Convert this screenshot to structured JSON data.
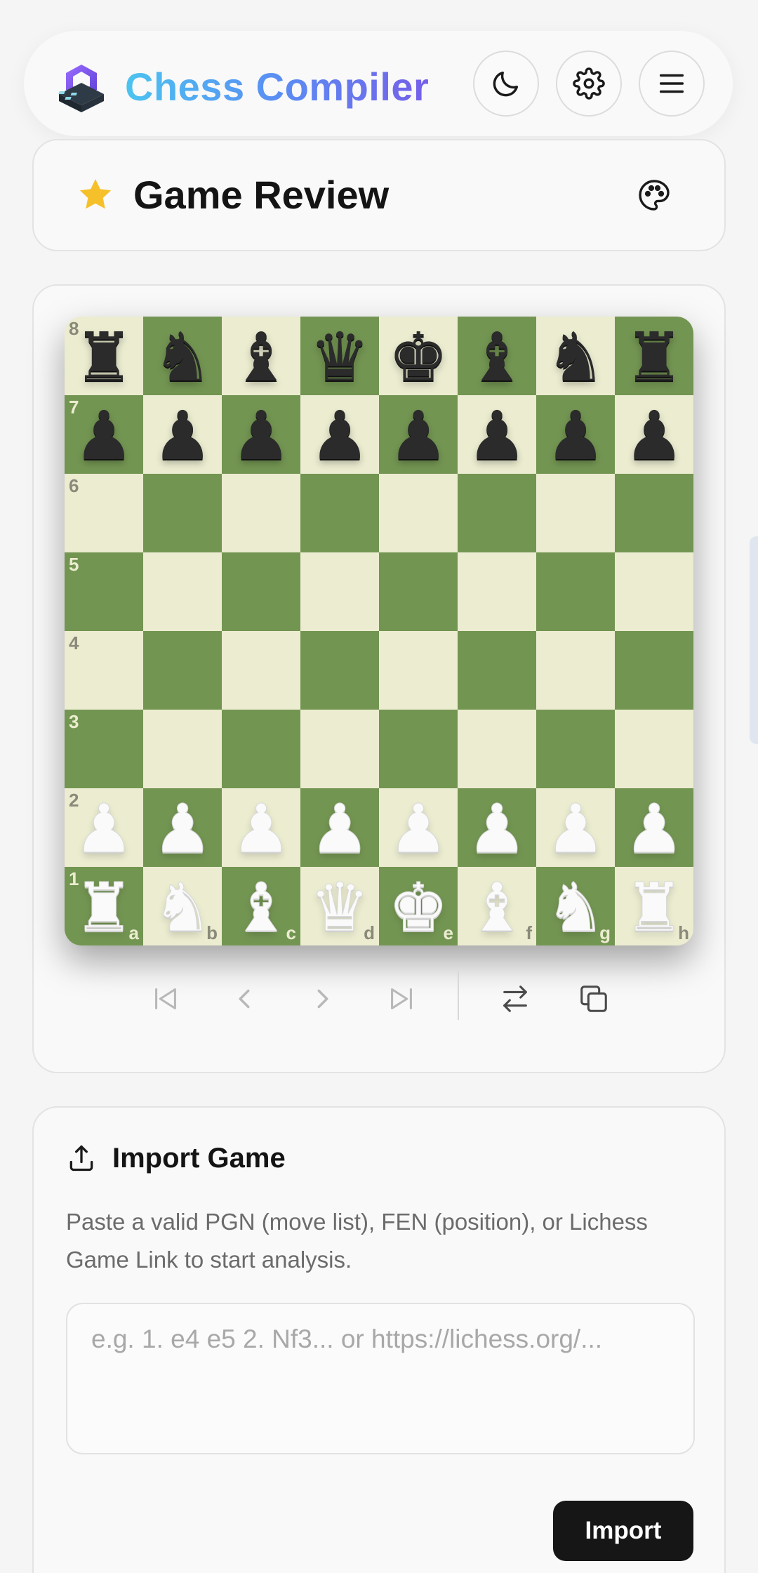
{
  "header": {
    "brand": "Chess Compiler",
    "brand_gradient": [
      "#4cc3f0",
      "#5a8ef3",
      "#7560e9"
    ],
    "buttons": [
      {
        "icon": "moon-icon",
        "name": "theme-toggle-button"
      },
      {
        "icon": "gear-icon",
        "name": "settings-button"
      },
      {
        "icon": "menu-icon",
        "name": "menu-button"
      }
    ]
  },
  "review": {
    "title": "Game Review",
    "star_color": "#f5c02a",
    "palette_icon": "palette-icon"
  },
  "board": {
    "light_color": "#ebecd0",
    "dark_color": "#739552",
    "files": [
      "a",
      "b",
      "c",
      "d",
      "e",
      "f",
      "g",
      "h"
    ],
    "ranks": [
      "8",
      "7",
      "6",
      "5",
      "4",
      "3",
      "2",
      "1"
    ],
    "position": [
      [
        "bR",
        "bN",
        "bB",
        "bQ",
        "bK",
        "bB",
        "bN",
        "bR"
      ],
      [
        "bP",
        "bP",
        "bP",
        "bP",
        "bP",
        "bP",
        "bP",
        "bP"
      ],
      [
        "",
        "",
        "",
        "",
        "",
        "",
        "",
        ""
      ],
      [
        "",
        "",
        "",
        "",
        "",
        "",
        "",
        ""
      ],
      [
        "",
        "",
        "",
        "",
        "",
        "",
        "",
        ""
      ],
      [
        "",
        "",
        "",
        "",
        "",
        "",
        "",
        ""
      ],
      [
        "wP",
        "wP",
        "wP",
        "wP",
        "wP",
        "wP",
        "wP",
        "wP"
      ],
      [
        "wR",
        "wN",
        "wB",
        "wQ",
        "wK",
        "wB",
        "wN",
        "wR"
      ]
    ],
    "controls": [
      {
        "icon": "skip-first-icon",
        "name": "first-move-button"
      },
      {
        "icon": "chevron-left-icon",
        "name": "previous-move-button"
      },
      {
        "icon": "chevron-right-icon",
        "name": "next-move-button"
      },
      {
        "icon": "skip-last-icon",
        "name": "last-move-button"
      },
      {
        "icon": "flip-board-icon",
        "name": "flip-board-button"
      },
      {
        "icon": "copy-icon",
        "name": "copy-button"
      }
    ]
  },
  "import": {
    "title": "Import Game",
    "description": "Paste a valid PGN (move list), FEN (position), or Lichess Game Link to start analysis.",
    "placeholder": "e.g. 1. e4 e5 2. Nf3... or https://lichess.org/...",
    "value": "",
    "button_label": "Import"
  }
}
